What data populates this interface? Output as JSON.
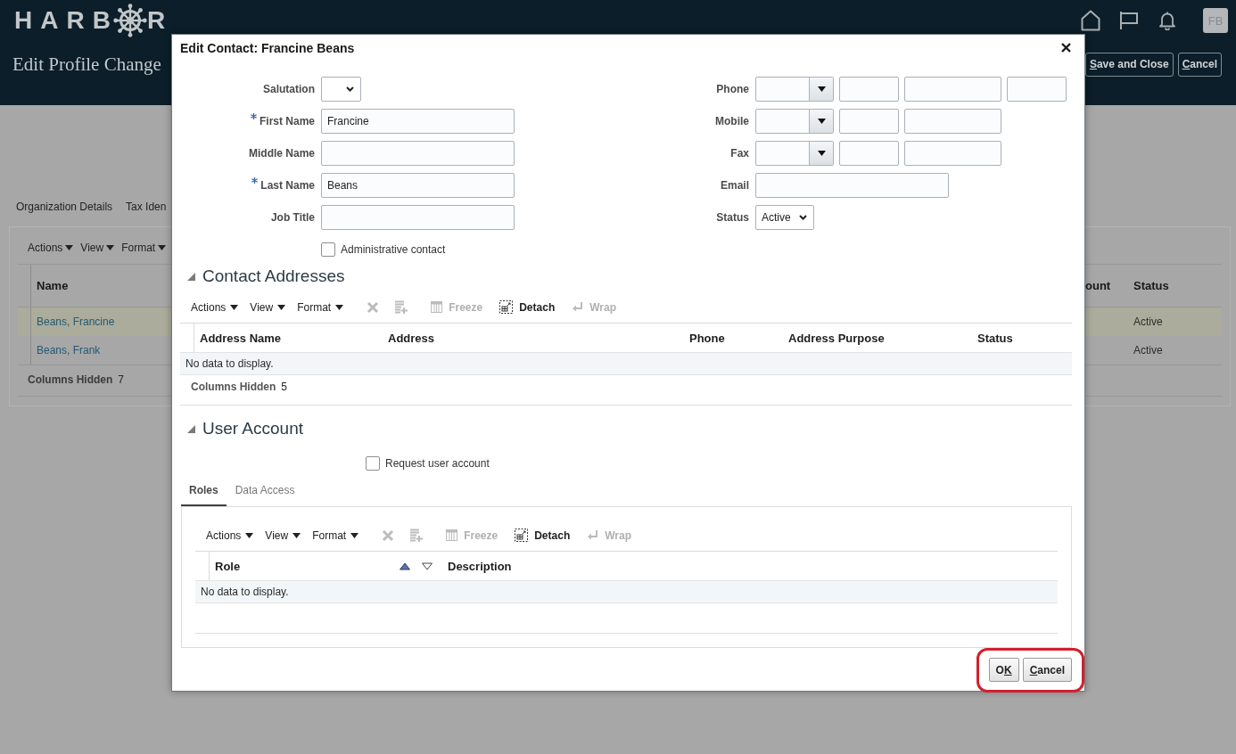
{
  "header": {
    "logo": {
      "letters_before_mark": "HARB",
      "letters_after_mark": "R"
    },
    "avatar": "FB",
    "title": "Edit Profile Change",
    "buttons": [
      {
        "label": "Save and Close",
        "first_letter_underlined": true,
        "second_letter_underlined": false
      },
      {
        "label": "Cancel",
        "first_letter_underlined": true,
        "second_letter_underlined": false
      }
    ]
  },
  "page_tabs": [
    {
      "label": "Organization Details",
      "selected": false
    },
    {
      "label": "Tax Iden",
      "selected": false
    }
  ],
  "contacts_table": {
    "toolbar": [
      {
        "label": "Actions"
      },
      {
        "label": "View"
      },
      {
        "label": "Format"
      }
    ],
    "columns": [
      "Name",
      "ount",
      "Status"
    ],
    "rows": [
      {
        "name": "Beans, Francine",
        "status": "Active",
        "selected": true
      },
      {
        "name": "Beans, Frank",
        "status": "Active",
        "selected": false
      }
    ],
    "columns_hidden": {
      "label": "Columns Hidden",
      "count": "7"
    }
  },
  "dialog": {
    "title": "Edit Contact: Francine Beans",
    "person_fields": [
      {
        "label": "Salutation",
        "kind": "select",
        "required": false
      },
      {
        "label": "First Name",
        "kind": "text",
        "required": true,
        "value": "Francine"
      },
      {
        "label": "Middle Name",
        "kind": "text",
        "required": false
      },
      {
        "label": "Last Name",
        "kind": "text",
        "required": true,
        "value": "Beans"
      },
      {
        "label": "Job Title",
        "kind": "text",
        "required": false
      }
    ],
    "administrative_contact": {
      "label": "Administrative contact",
      "checked": false
    },
    "contact_fields": [
      {
        "label": "Phone",
        "kind": "phone",
        "extension": true
      },
      {
        "label": "Mobile",
        "kind": "phone",
        "extension": false
      },
      {
        "label": "Fax",
        "kind": "phone",
        "extension": false
      },
      {
        "label": "Email",
        "kind": "text"
      },
      {
        "label": "Status",
        "kind": "select",
        "value": "Active"
      }
    ],
    "contact_addresses": {
      "title": "Contact Addresses",
      "expanded": true,
      "toolbar": {
        "menus": [
          {
            "label": "Actions"
          },
          {
            "label": "View"
          },
          {
            "label": "Format"
          }
        ],
        "actions": [
          {
            "kind": "delete",
            "disabled": true
          },
          {
            "kind": "add_row",
            "disabled": true
          },
          {
            "kind": "freeze",
            "label": "Freeze",
            "disabled": true
          },
          {
            "kind": "detach",
            "label": "Detach",
            "disabled": false
          },
          {
            "kind": "wrap",
            "label": "Wrap",
            "disabled": true
          }
        ]
      },
      "columns": [
        "Address Name",
        "Address",
        "Phone",
        "Address Purpose",
        "Status"
      ],
      "empty_message": "No data to display.",
      "columns_hidden": {
        "label": "Columns Hidden",
        "count": "5"
      }
    },
    "user_account": {
      "title": "User Account",
      "expanded": true,
      "request_user_account": {
        "label": "Request user account",
        "checked": false
      },
      "tabs": [
        {
          "label": "Roles",
          "selected": true
        },
        {
          "label": "Data Access",
          "selected": false
        }
      ],
      "roles_table": {
        "toolbar": {
          "menus": [
            {
              "label": "Actions"
            },
            {
              "label": "View"
            },
            {
              "label": "Format"
            }
          ],
          "actions": [
            {
              "kind": "delete",
              "disabled": true
            },
            {
              "kind": "add_row",
              "disabled": true
            },
            {
              "kind": "freeze",
              "label": "Freeze",
              "disabled": true
            },
            {
              "kind": "detach",
              "label": "Detach",
              "disabled": false
            },
            {
              "kind": "wrap",
              "label": "Wrap",
              "disabled": true
            }
          ]
        },
        "columns": [
          {
            "label": "Role",
            "sortable": true,
            "sorted_ascending": true
          },
          {
            "label": "Description",
            "sortable": false
          }
        ],
        "empty_message": "No data to display."
      }
    },
    "footer": {
      "highlighted": true,
      "buttons": [
        {
          "label": "OK",
          "first_letter_underlined": false,
          "second_letter_underlined": true
        },
        {
          "label": "Cancel",
          "first_letter_underlined": true,
          "second_letter_underlined": false
        }
      ]
    }
  }
}
